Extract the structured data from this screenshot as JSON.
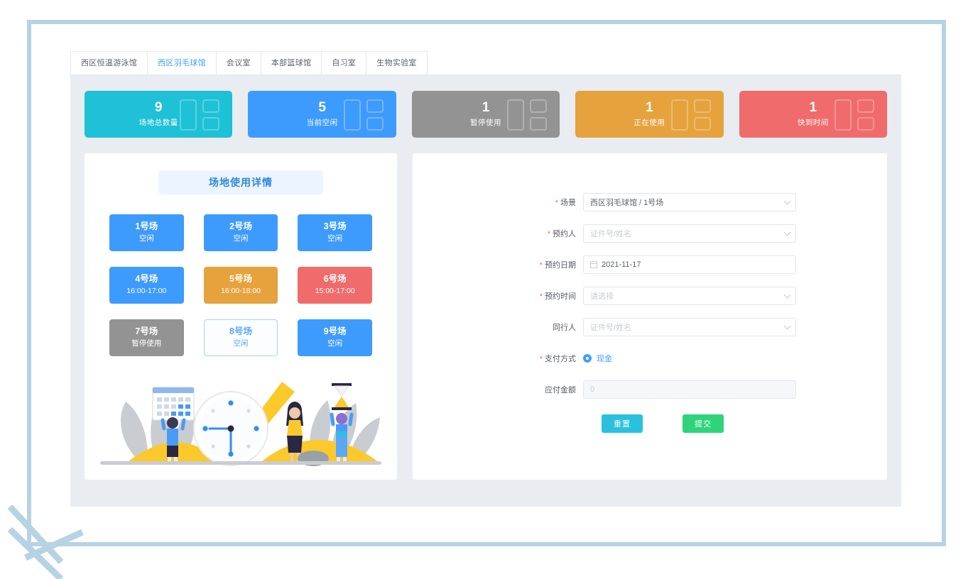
{
  "theme": {
    "frame_border": "#b6d3e4",
    "page_bg": "#e9ecf0",
    "accent_blue": "#409eff",
    "teal": "#1ec1d6",
    "gray": "#939393",
    "orange": "#e6a23c",
    "red": "#f06b6b",
    "green": "#2fd37c",
    "cyan_btn": "#29c1dd"
  },
  "tabs": [
    {
      "label": "西区恒温游泳馆",
      "active": false
    },
    {
      "label": "西区羽毛球馆",
      "active": true
    },
    {
      "label": "会议室",
      "active": false
    },
    {
      "label": "本部篮球馆",
      "active": false
    },
    {
      "label": "自习室",
      "active": false
    },
    {
      "label": "生物实验室",
      "active": false
    }
  ],
  "stats": [
    {
      "value": "9",
      "label": "场地总数量",
      "color": "#1ec1d6"
    },
    {
      "value": "5",
      "label": "当前空闲",
      "color": "#3d9bfd"
    },
    {
      "value": "1",
      "label": "暂停使用",
      "color": "#939393"
    },
    {
      "value": "1",
      "label": "正在使用",
      "color": "#e6a23c"
    },
    {
      "value": "1",
      "label": "快到时间",
      "color": "#f06b6b"
    }
  ],
  "detail": {
    "title": "场地使用详情",
    "courts": [
      {
        "name": "1号场",
        "status": "空闲",
        "color": "#3d9bfd",
        "selected": false
      },
      {
        "name": "2号场",
        "status": "空闲",
        "color": "#3d9bfd",
        "selected": false
      },
      {
        "name": "3号场",
        "status": "空闲",
        "color": "#3d9bfd",
        "selected": false
      },
      {
        "name": "4号场",
        "status": "16:00-17:00",
        "color": "#3d9bfd",
        "selected": false
      },
      {
        "name": "5号场",
        "status": "16:00-18:00",
        "color": "#e6a23c",
        "selected": false
      },
      {
        "name": "6号场",
        "status": "15:00-17:00",
        "color": "#f06b6b",
        "selected": false
      },
      {
        "name": "7号场",
        "status": "暂停使用",
        "color": "#939393",
        "selected": false
      },
      {
        "name": "8号场",
        "status": "空闲",
        "color": "#3d9bfd",
        "selected": true
      },
      {
        "name": "9号场",
        "status": "空闲",
        "color": "#3d9bfd",
        "selected": false
      }
    ],
    "illustration_name": "time-management-illustration"
  },
  "form": {
    "venue": {
      "label": "场景",
      "required": true,
      "value": "西区羽毛球馆 / 1号场",
      "type": "select"
    },
    "booker": {
      "label": "预约人",
      "required": true,
      "placeholder": "证件号/姓名",
      "value": "",
      "type": "select"
    },
    "date": {
      "label": "预约日期",
      "required": true,
      "value": "2021-11-17",
      "type": "date"
    },
    "time": {
      "label": "预约时间",
      "required": true,
      "placeholder": "请选择",
      "value": "",
      "type": "select"
    },
    "companion": {
      "label": "同行人",
      "required": false,
      "placeholder": "证件号/姓名",
      "value": "",
      "type": "select"
    },
    "payment": {
      "label": "支付方式",
      "required": true,
      "option_label": "现金",
      "selected": true
    },
    "amount": {
      "label": "应付金额",
      "required": false,
      "value": "0",
      "disabled": true
    },
    "reset_label": "重置",
    "submit_label": "提交"
  }
}
